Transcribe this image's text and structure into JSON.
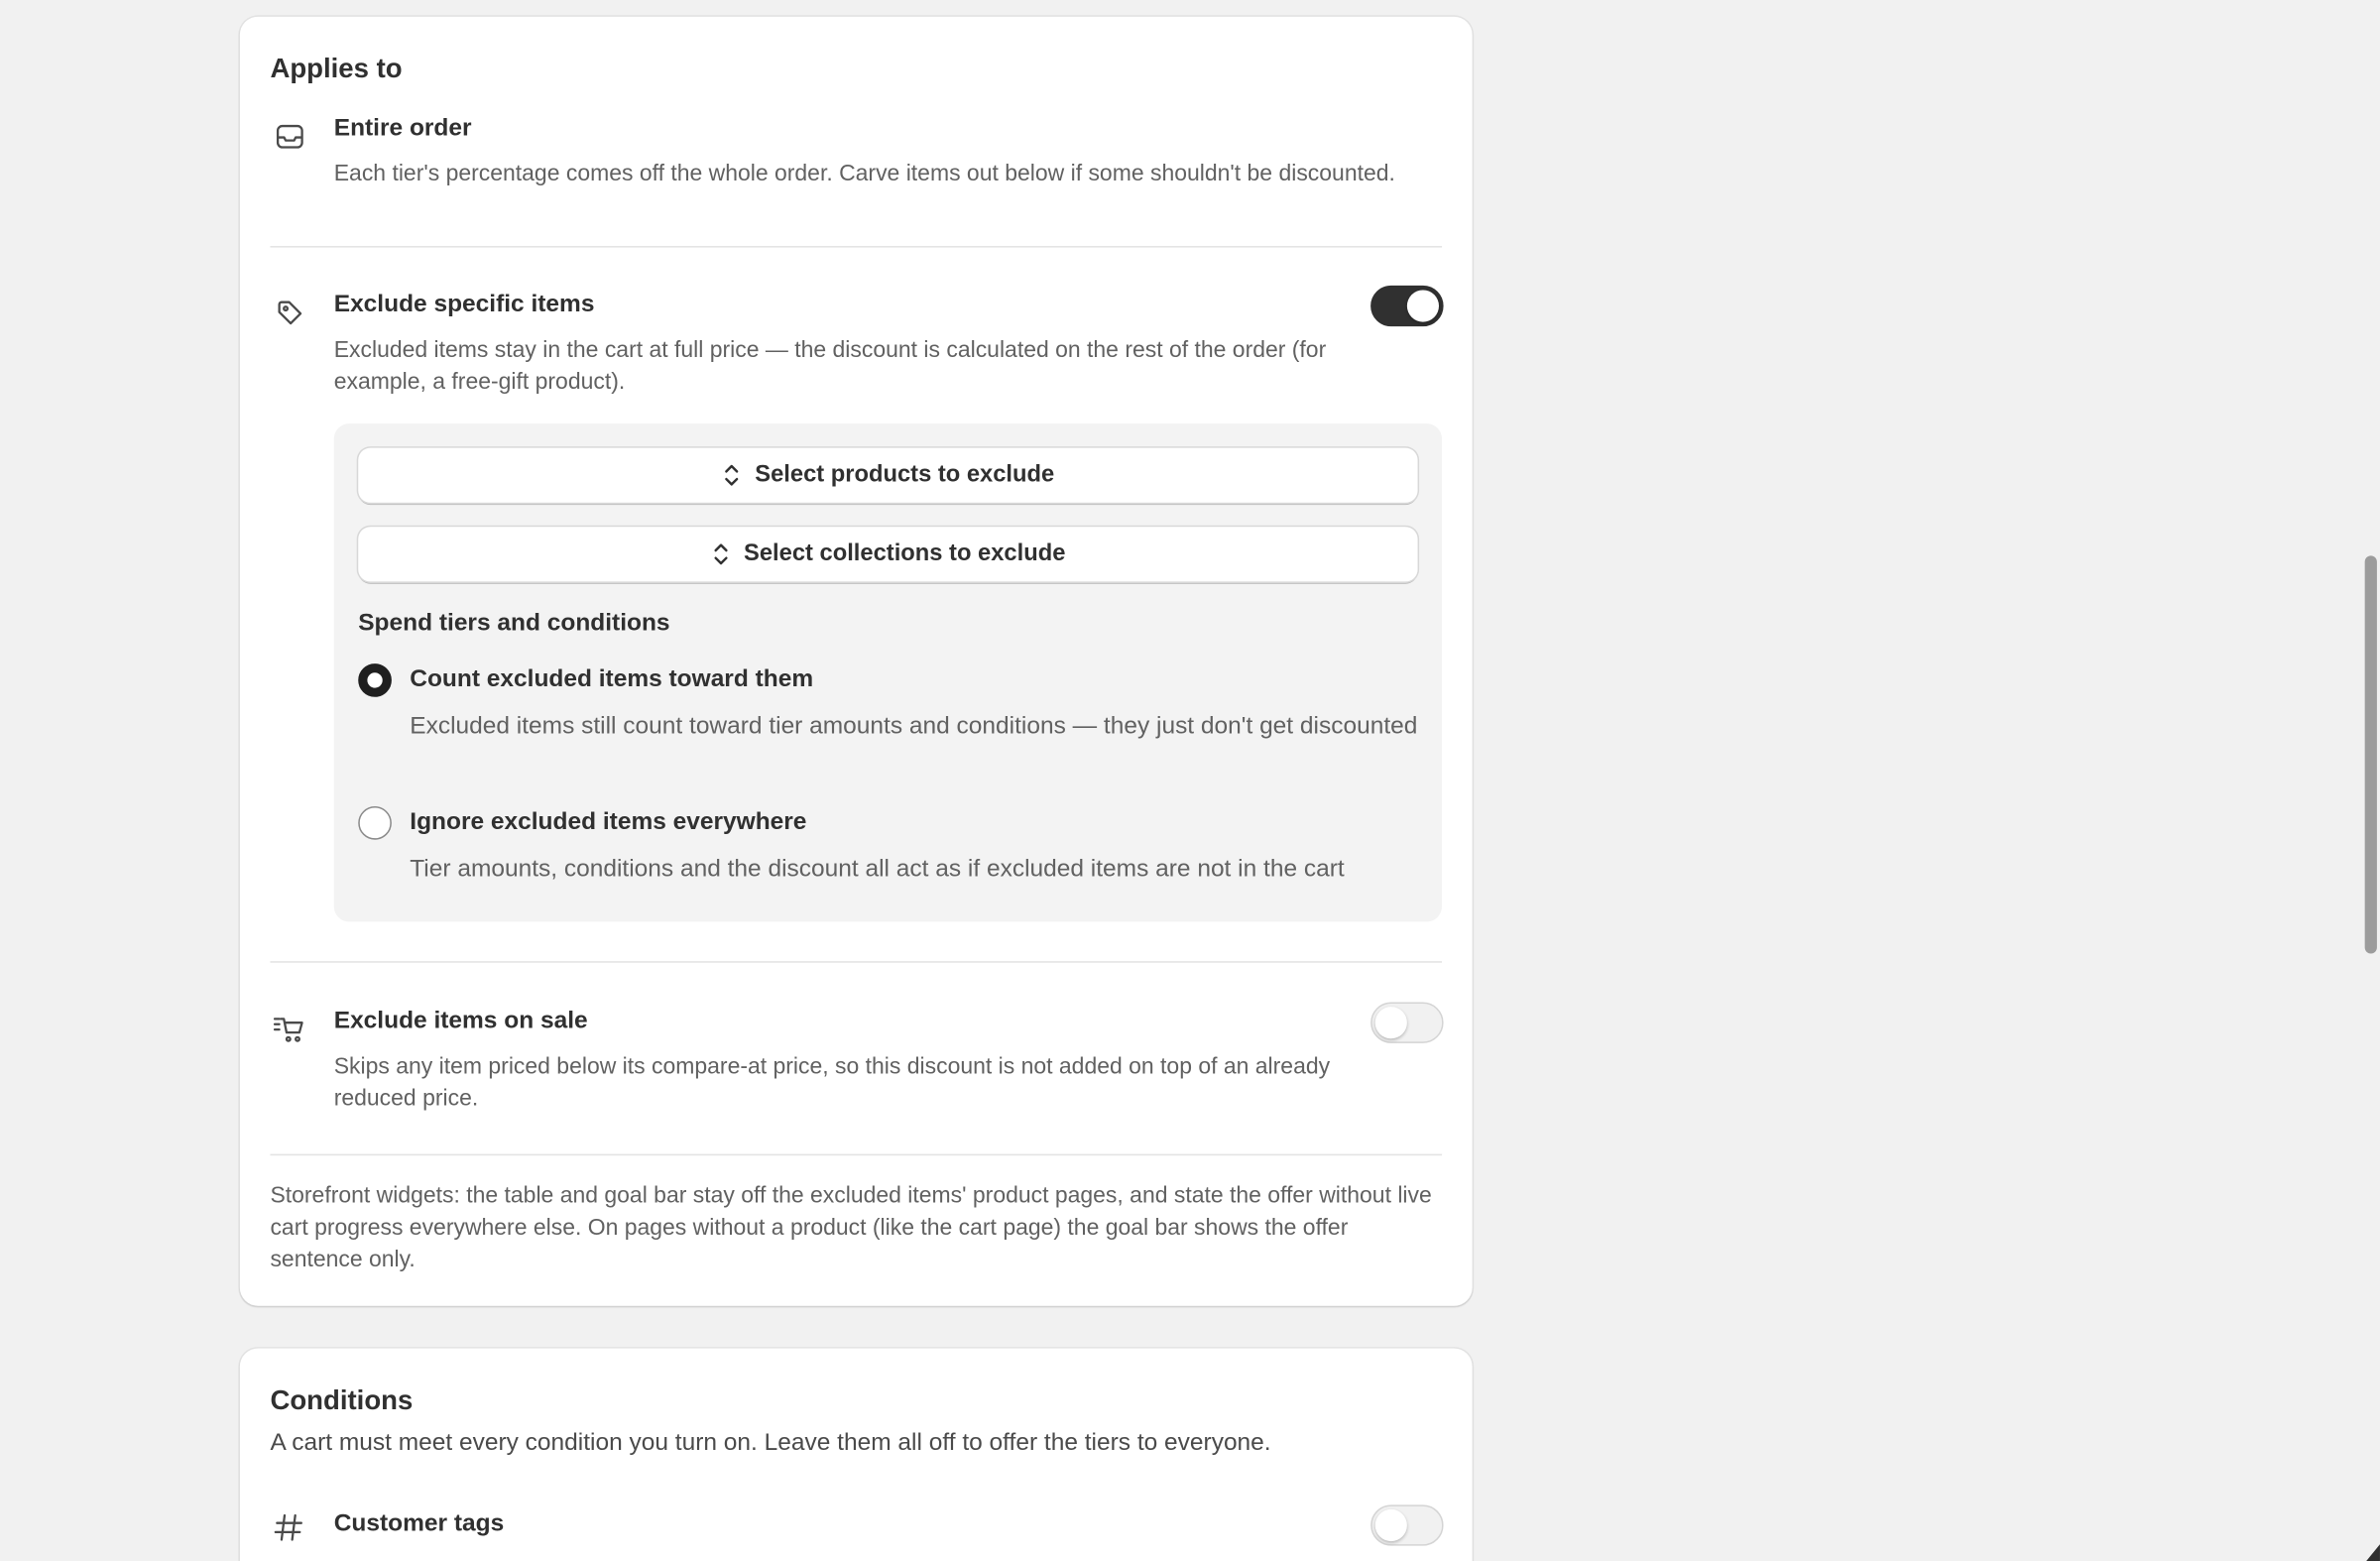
{
  "applies_to": {
    "title": "Applies to",
    "entire_order": {
      "icon": "inbox-icon",
      "title": "Entire order",
      "description": "Each tier's percentage comes off the whole order. Carve items out below if some shouldn't be discounted."
    },
    "exclude_specific": {
      "icon": "tag-icon",
      "title": "Exclude specific items",
      "description": "Excluded items stay in the cart at full price — the discount is calculated on the rest of the order (for example, a free-gift product).",
      "enabled": true,
      "select_products_label": "Select products to exclude",
      "select_collections_label": "Select collections to exclude",
      "spend_tiers_title": "Spend tiers and conditions",
      "options": [
        {
          "label": "Count excluded items toward them",
          "description": "Excluded items still count toward tier amounts and conditions — they just don't get discounted",
          "selected": true
        },
        {
          "label": "Ignore excluded items everywhere",
          "description": "Tier amounts, conditions and the discount all act as if excluded items are not in the cart",
          "selected": false
        }
      ]
    },
    "exclude_sale": {
      "icon": "cart-sale-icon",
      "title": "Exclude items on sale",
      "description": "Skips any item priced below its compare-at price, so this discount is not added on top of an already reduced price.",
      "enabled": false
    },
    "storefront_note": "Storefront widgets: the table and goal bar stay off the excluded items' product pages, and state the offer without live cart progress everywhere else. On pages without a product (like the cart page) the goal bar shows the offer sentence only."
  },
  "conditions": {
    "title": "Conditions",
    "description": "A cart must meet every condition you turn on. Leave them all off to offer the tiers to everyone.",
    "customer_tags": {
      "icon": "hash-icon",
      "title": "Customer tags",
      "enabled": false
    }
  },
  "colors": {
    "toggle_on": "#303030",
    "card_bg": "#ffffff",
    "page_bg": "#f1f1f1",
    "subpanel_bg": "#f3f3f3",
    "help_text": "#616161"
  }
}
